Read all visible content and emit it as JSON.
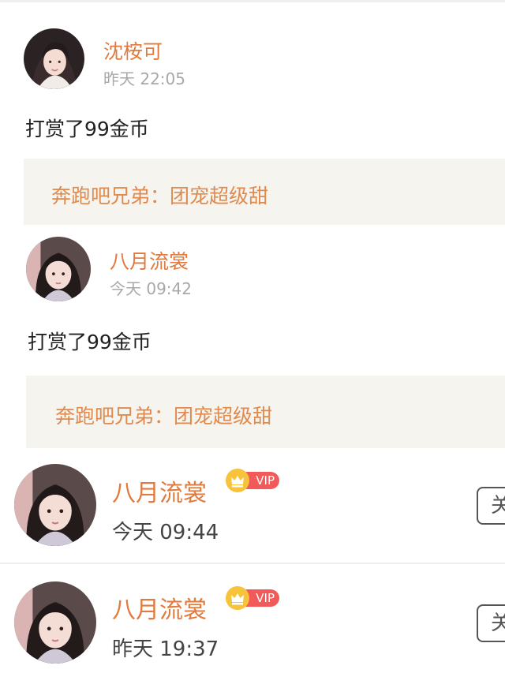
{
  "comments": [
    {
      "user_name": "沈桉可",
      "time": "昨天 22:05",
      "text": "打赏了99金币",
      "quote": "奔跑吧兄弟：团宠超级甜"
    },
    {
      "user_name": "八月流裳",
      "time": "今天 09:42",
      "text": "打赏了99金币",
      "quote": "奔跑吧兄弟：团宠超级甜"
    }
  ],
  "followers": [
    {
      "user_name": "八月流裳",
      "vip_label": "VIP",
      "time": "今天 09:44",
      "follow_label": "关"
    },
    {
      "user_name": "八月流裳",
      "vip_label": "VIP",
      "time": "昨天 19:37",
      "follow_label": "关"
    }
  ],
  "colors": {
    "username": "#e07a3e",
    "timestamp": "#a8a8a8",
    "quote_background": "#f5f4ef",
    "vip_pill": "#f25a5a",
    "crown": "#f6c33a"
  }
}
